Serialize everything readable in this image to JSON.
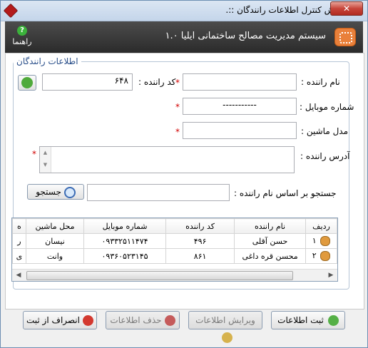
{
  "window": {
    "title": "بخش کنترل اطلاعات رانندگان ::."
  },
  "header": {
    "system_title": "سیستم مدیریت مصالح ساختمانی ایلیا ۱.۰",
    "help_label": "راهنما"
  },
  "form": {
    "group_title": "اطلاعات رانندگان",
    "driver_name_label": "نام راننده :",
    "driver_code_label": "کد راننده :",
    "driver_code_value": "۶۴۸",
    "mobile_label": "شماره موبایل :",
    "mobile_value": "-----------",
    "car_model_label": "مدل ماشین :",
    "address_label": "آدرس راننده :",
    "search_label": "جستجو بر اساس نام راننده :",
    "search_button": "جستجو",
    "required_mark": "*"
  },
  "table": {
    "columns": [
      "ه",
      "محل ماشین",
      "شماره موبایل",
      "کد راننده",
      "نام راننده",
      "ردیف"
    ],
    "rows": [
      [
        "ر",
        "نیسان",
        "۰۹۳۳۲۵۱۱۴۷۴",
        "۴۹۶",
        "حسن آقلی",
        "۱"
      ],
      [
        "ی",
        "وانت",
        "۰۹۳۶۰۵۲۳۱۴۵",
        "۸۶۱",
        "محسن قره داغی",
        "۲"
      ]
    ]
  },
  "buttons": {
    "save": "ثبت اطلاعات",
    "edit": "ویرایش اطلاعات",
    "delete": "حذف اطلاعات",
    "cancel": "انصراف از ثبت"
  }
}
